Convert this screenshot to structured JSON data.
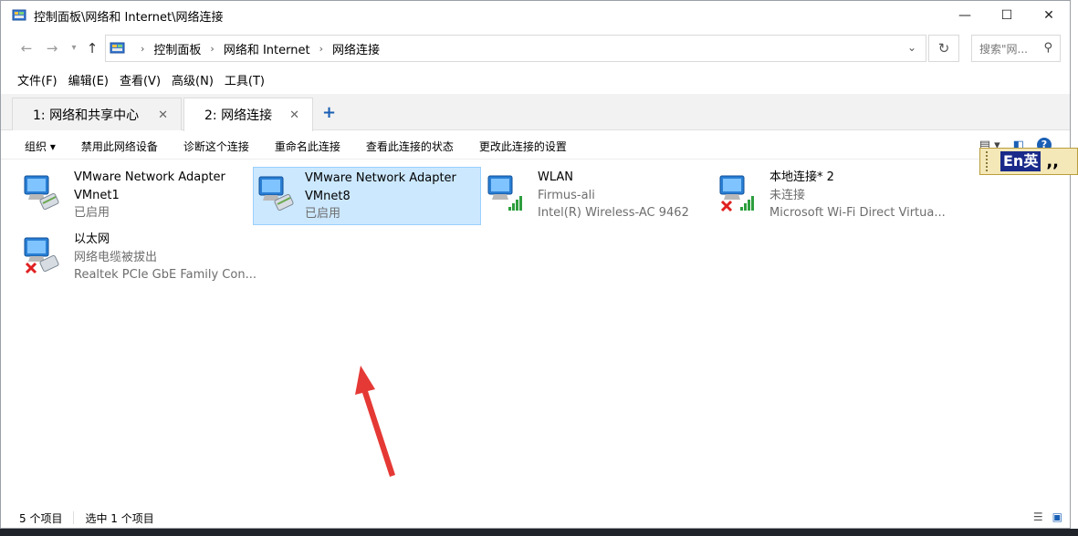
{
  "window": {
    "title": "控制面板\\网络和 Internet\\网络连接",
    "controls": {
      "minimize": "—",
      "maximize": "☐",
      "close": "✕"
    }
  },
  "address": {
    "crumbs": [
      "控制面板",
      "网络和 Internet",
      "网络连接"
    ],
    "search_placeholder": "搜索\"网..."
  },
  "menu": [
    "文件(F)",
    "编辑(E)",
    "查看(V)",
    "高级(N)",
    "工具(T)"
  ],
  "tabs": [
    {
      "label": "1: 网络和共享中心"
    },
    {
      "label": "2: 网络连接"
    }
  ],
  "commands": [
    "组织 ▾",
    "禁用此网络设备",
    "诊断这个连接",
    "重命名此连接",
    "查看此连接的状态",
    "更改此连接的设置"
  ],
  "connections": [
    {
      "name": "VMware Network Adapter VMnet1",
      "name_line1": "VMware Network Adapter",
      "name_line2": "VMnet1",
      "status": "已启用",
      "device": "",
      "icon": "network-adapter-icon"
    },
    {
      "name": "VMware Network Adapter VMnet8",
      "name_line1": "VMware Network Adapter",
      "name_line2": "VMnet8",
      "status": "已启用",
      "device": "",
      "icon": "network-adapter-icon",
      "selected": true
    },
    {
      "name": "WLAN",
      "name_line1": "WLAN",
      "name_line2": "",
      "status": "Firmus-ali",
      "device": "Intel(R) Wireless-AC 9462",
      "icon": "wifi-adapter-icon"
    },
    {
      "name": "本地连接* 2",
      "name_line1": "本地连接* 2",
      "name_line2": "",
      "status": "未连接",
      "device": "Microsoft Wi-Fi Direct Virtua...",
      "icon": "wifi-adapter-disconnected-icon"
    },
    {
      "name": "以太网",
      "name_line1": "以太网",
      "name_line2": "",
      "status": "网络电缆被拔出",
      "device": "Realtek PCIe GbE Family Con...",
      "icon": "ethernet-disconnected-icon"
    }
  ],
  "statusbar": {
    "count": "5 个项目",
    "selected": "选中 1 个项目"
  },
  "ime": {
    "mode": "En英",
    "punct": ",,"
  },
  "colors": {
    "selection_bg": "#cce8ff",
    "selection_border": "#99d1ff",
    "annotation_arrow": "#e53935",
    "error_x": "#e02020",
    "signal_green": "#2e9e3e"
  }
}
